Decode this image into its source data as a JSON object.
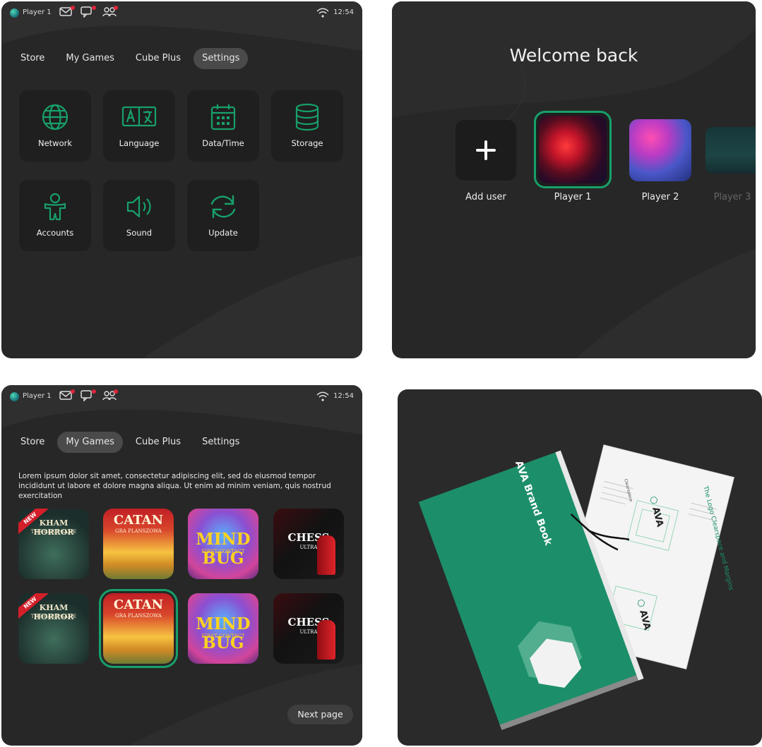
{
  "colors": {
    "accent": "#17a06a",
    "panel": "#272727",
    "tile": "#1f1f1f",
    "badge": "#e0243a"
  },
  "status": {
    "player": "Player 1",
    "time": "12:54",
    "icons": [
      "mail-icon",
      "chat-icon",
      "friends-icon",
      "wifi-icon"
    ]
  },
  "settings_screen": {
    "tabs": [
      "Store",
      "My Games",
      "Cube Plus",
      "Settings"
    ],
    "active_tab": "Settings",
    "tiles": [
      {
        "label": "Network",
        "icon": "globe-icon"
      },
      {
        "label": "Language",
        "icon": "translate-icon"
      },
      {
        "label": "Data/Time",
        "icon": "calendar-icon"
      },
      {
        "label": "Storage",
        "icon": "database-icon"
      },
      {
        "label": "Accounts",
        "icon": "person-icon"
      },
      {
        "label": "Sound",
        "icon": "speaker-icon"
      },
      {
        "label": "Update",
        "icon": "refresh-icon"
      }
    ]
  },
  "welcome_screen": {
    "title": "Welcome back",
    "users": [
      {
        "label": "Add user",
        "icon": "plus-icon"
      },
      {
        "label": "Player 1"
      },
      {
        "label": "Player 2"
      },
      {
        "label": "Player 3"
      }
    ],
    "selected": "Player 1"
  },
  "games_screen": {
    "tabs": [
      "Store",
      "My Games",
      "Cube Plus",
      "Settings"
    ],
    "active_tab": "My Games",
    "description": "Lorem ipsum dolor sit amet, consectetur adipiscing elit, sed do eiusmod tempor incididunt ut labore et dolore magna aliqua. Ut enim ad minim veniam, quis nostrud exercitation",
    "games": [
      {
        "title": "KHAM HORROR",
        "subtitle": "THE CARD GAME",
        "badge": "NEW"
      },
      {
        "title": "CATAN",
        "subtitle": "GRA PLANSZOWA"
      },
      {
        "title": "MIND BUG",
        "subtitle": "FIRST CONTACT"
      },
      {
        "title": "CHESS",
        "subtitle": "ULTRA"
      }
    ],
    "next_label": "Next page"
  },
  "brand_book": {
    "cover_title": "AVA Brand Book",
    "page_heading": "The Logo Clearspace and Margins",
    "logo_text": "AVA",
    "page_subheading": "Clearspace"
  }
}
